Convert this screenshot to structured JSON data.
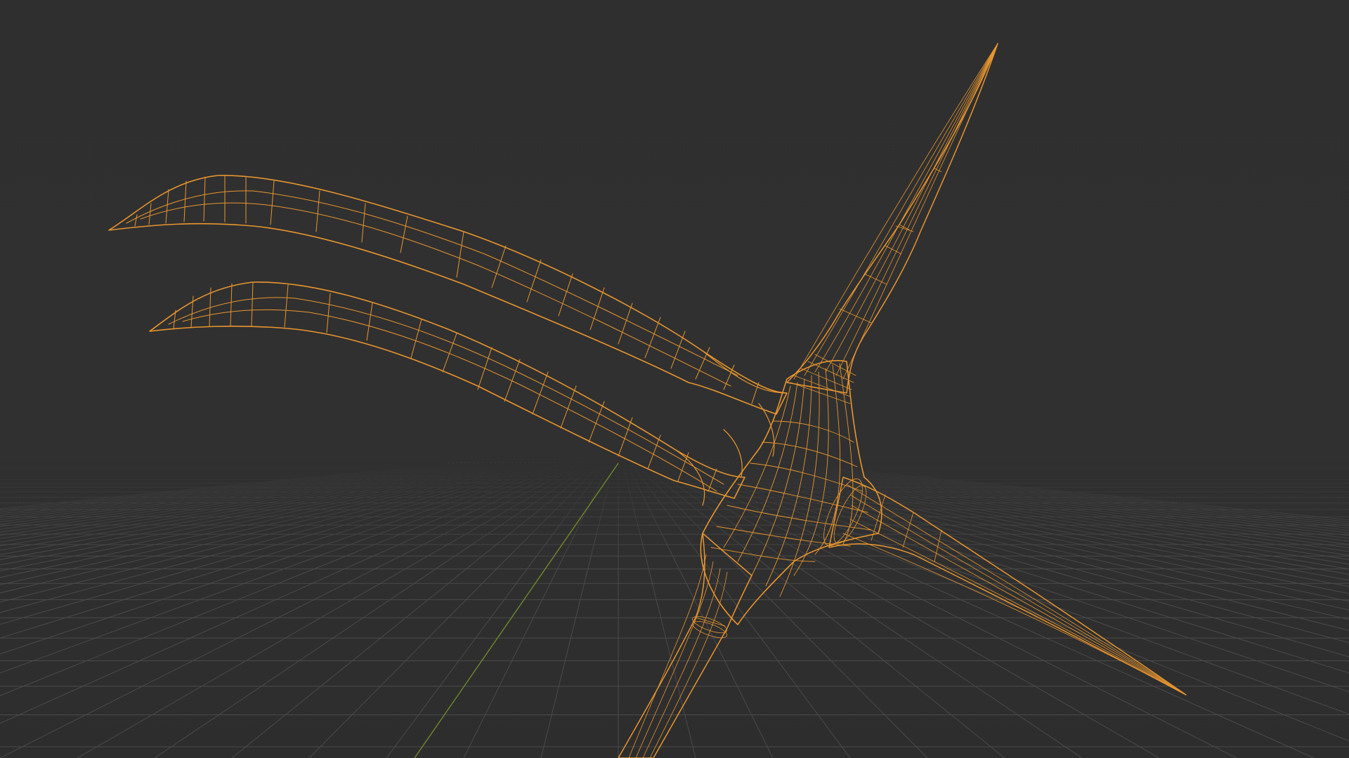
{
  "viewport": {
    "background_color": "#2f2f2f",
    "grid_color": "#4a4a4a",
    "y_axis_color": "#6f8a2c",
    "wireframe_color": "#e8962f",
    "shading_mode": "wireframe",
    "object_selected": true
  }
}
